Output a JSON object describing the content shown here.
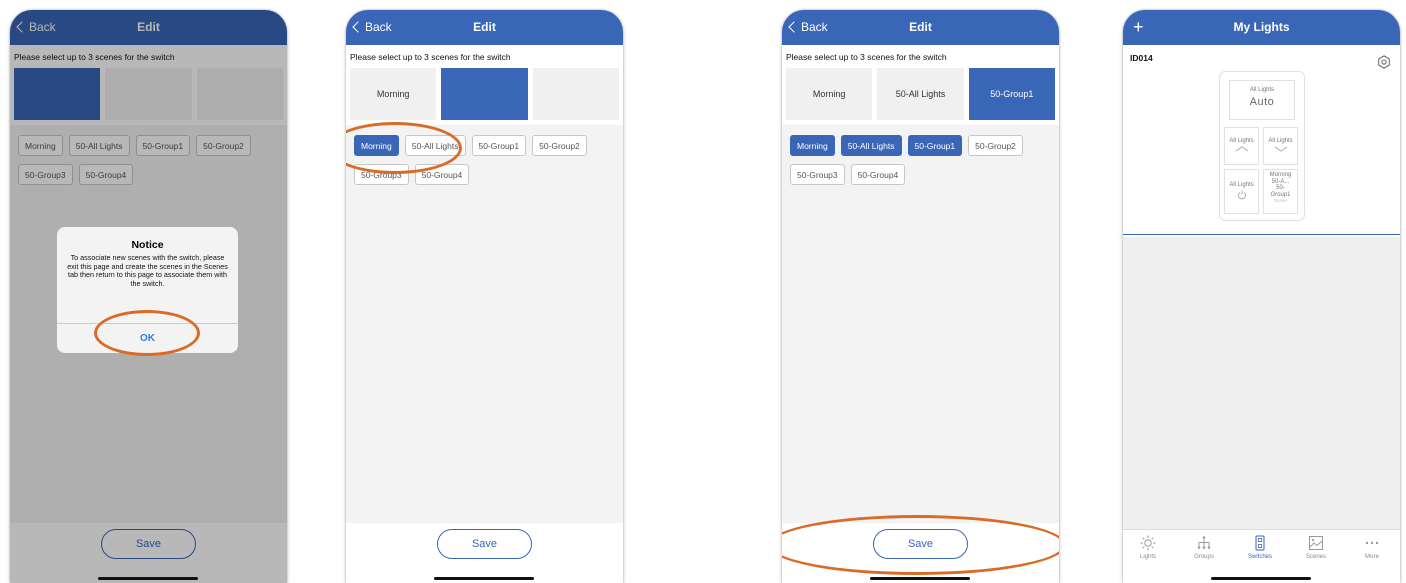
{
  "edit_nav": {
    "back_label": "Back",
    "title": "Edit"
  },
  "instruction": "Please select up to 3 scenes for the switch",
  "save_label": "Save",
  "screen1": {
    "tiles": [
      "",
      "",
      ""
    ],
    "chips": [
      "Morning",
      "50-All Lights",
      "50-Group1",
      "50-Group2",
      "50-Group3",
      "50-Group4"
    ],
    "notice": {
      "title": "Notice",
      "message": "To associate new scenes with the switch, please exit this page and create the scenes in the Scenes tab then return to this page to associate them with the switch.",
      "ok_label": "OK"
    }
  },
  "screen2": {
    "tiles": [
      "Morning",
      "",
      ""
    ],
    "chips": [
      "Morning",
      "50-All Lights",
      "50-Group1",
      "50-Group2",
      "50-Group3",
      "50-Group4"
    ]
  },
  "screen3": {
    "tiles": [
      "Morning",
      "50-All Lights",
      "50-Group1"
    ],
    "chips": [
      "Morning",
      "50-All Lights",
      "50-Group1",
      "50-Group2",
      "50-Group3",
      "50-Group4"
    ]
  },
  "screen4": {
    "title": "My Lights",
    "switch_id": "ID014",
    "device": {
      "top_small": "All Lights",
      "top_big": "Auto",
      "up_label": "All Lights",
      "down_label": "All Lights",
      "power_label": "All Lights",
      "scene_lines": [
        "Morning",
        "50-A...",
        "50-",
        "Group1"
      ],
      "scene_caption": "Scene"
    },
    "tabs": [
      "Lights",
      "Groups",
      "Switches",
      "Scenes",
      "More"
    ]
  },
  "colors": {
    "accent": "#3a66b8",
    "highlight_ring": "#d96b27",
    "dialog_button": "#2b7de8"
  }
}
